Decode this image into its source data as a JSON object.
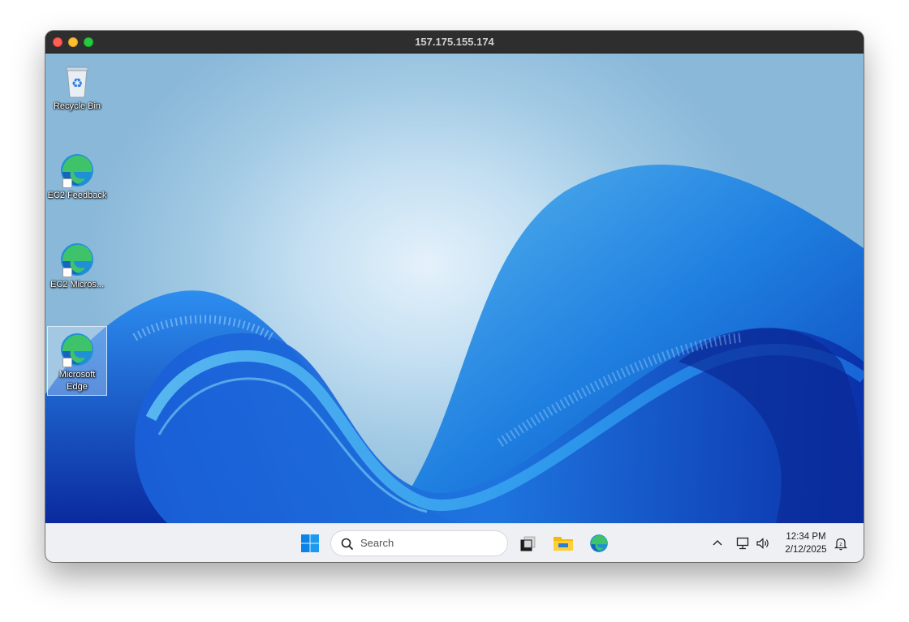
{
  "window": {
    "title": "157.175.155.174"
  },
  "desktop": {
    "icons": [
      {
        "label": "Recycle Bin",
        "icon": "recycle-bin-icon"
      },
      {
        "label": "EC2 Feedback",
        "icon": "edge-icon"
      },
      {
        "label": "EC2 Micros...",
        "icon": "edge-icon"
      },
      {
        "label": "Microsoft Edge",
        "icon": "edge-icon"
      }
    ]
  },
  "taskbar": {
    "start_icon": "windows-start-icon",
    "search_placeholder": "Search",
    "pinned": [
      "task-view-icon",
      "file-explorer-icon",
      "edge-icon"
    ],
    "tray": {
      "chevron_icon": "chevron-up-icon",
      "network_icon": "network-icon",
      "volume_icon": "volume-icon",
      "time": "12:34 PM",
      "date": "2/12/2025",
      "notification_icon": "notification-icon"
    }
  },
  "colors": {
    "accent": "#0078d4",
    "taskbar_bg": "#eef0f3",
    "titlebar_bg": "#2e2e2e"
  }
}
